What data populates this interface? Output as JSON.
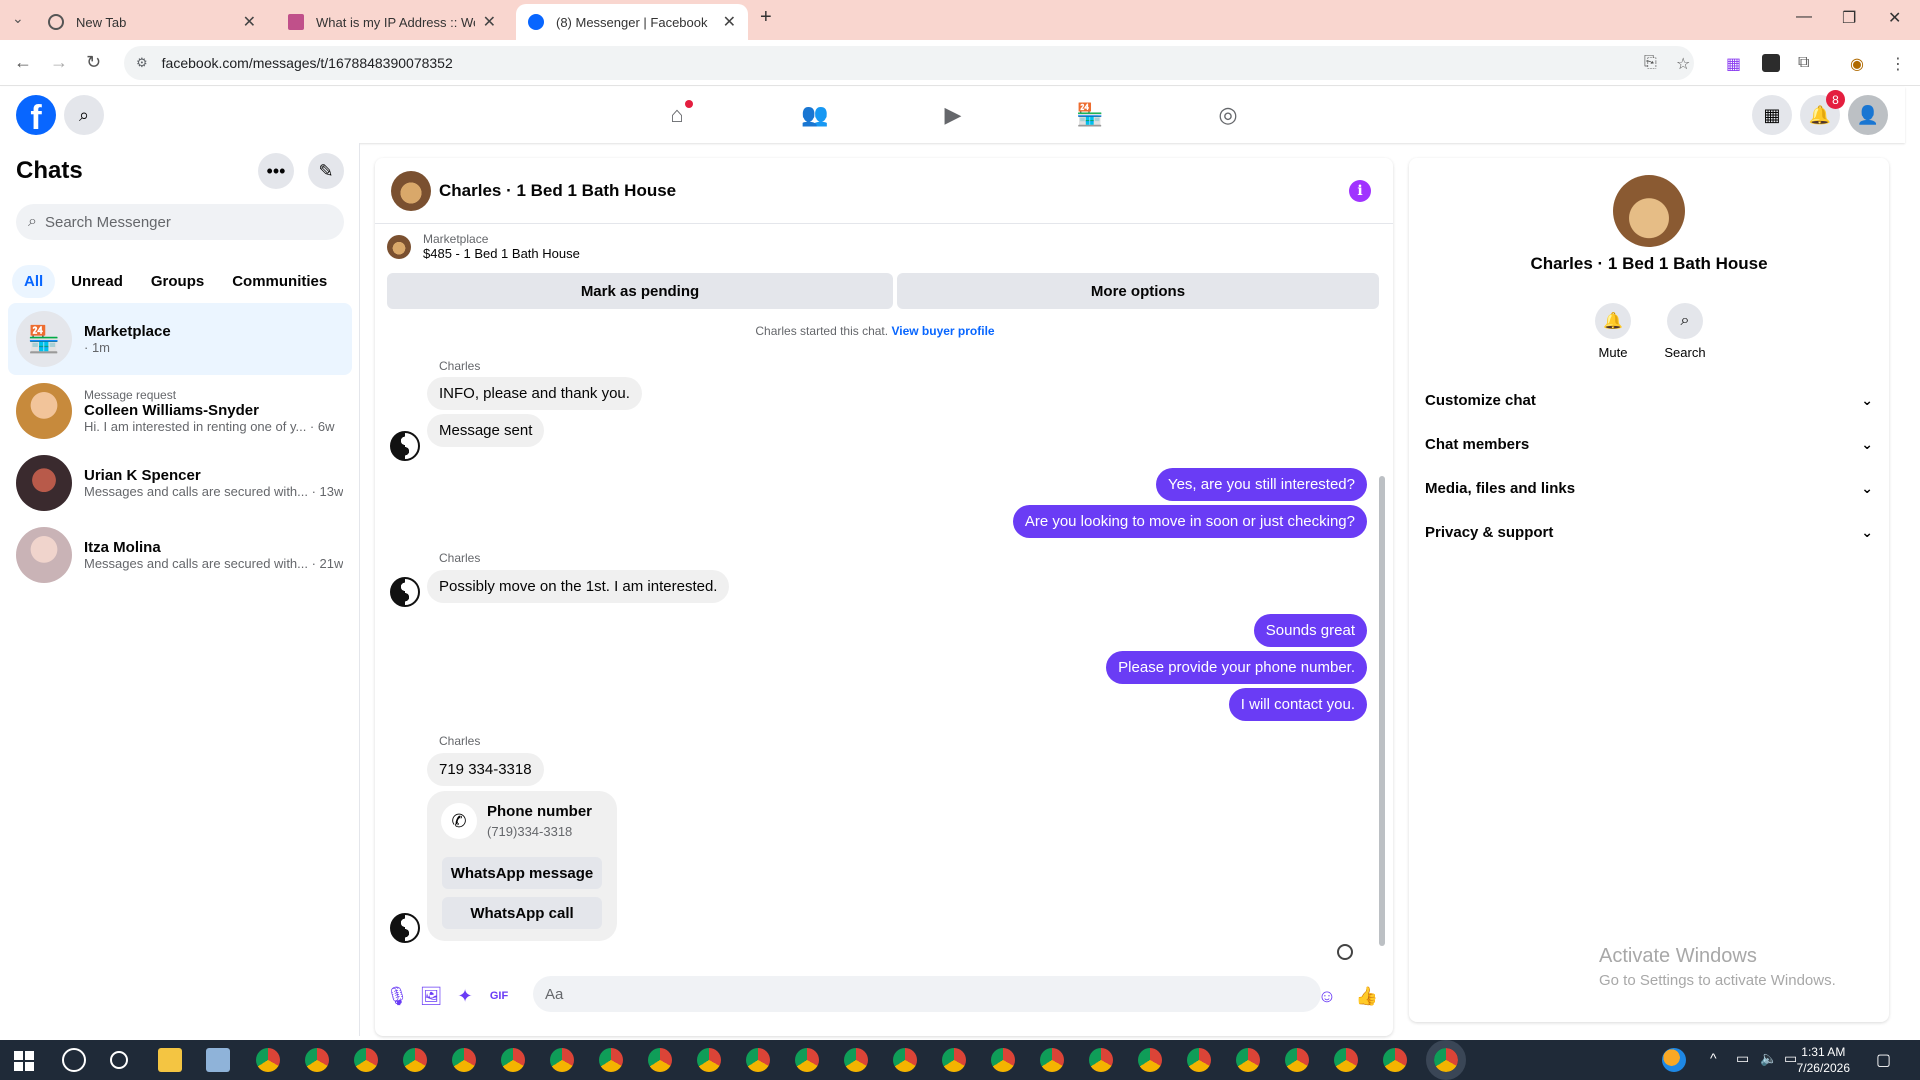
{
  "browser": {
    "tabs": [
      {
        "title": "New Tab"
      },
      {
        "title": "What is my IP Address :: WebBr"
      },
      {
        "title": "(8) Messenger | Facebook"
      }
    ],
    "url": "facebook.com/messages/t/1678848390078352"
  },
  "fb": {
    "notification_count": "8"
  },
  "sidebar": {
    "title": "Chats",
    "search_placeholder": "Search Messenger",
    "filters": [
      "All",
      "Unread",
      "Groups",
      "Communities"
    ],
    "chats": [
      {
        "name": "Marketplace",
        "sub": "· 1m",
        "req": ""
      },
      {
        "name": "Colleen Williams-Snyder",
        "sub": "Hi. I am interested in renting one of y...  · 6w",
        "req": "Message request"
      },
      {
        "name": "Urian K Spencer",
        "sub": "Messages and calls are secured with...  · 13w",
        "req": ""
      },
      {
        "name": "Itza Molina",
        "sub": "Messages and calls are secured with...  · 21w",
        "req": ""
      }
    ]
  },
  "conversation": {
    "title": "Charles · 1 Bed 1 Bath House",
    "marketplace_label": "Marketplace",
    "listing": "$485 - 1 Bed 1 Bath House",
    "mark_pending": "Mark as pending",
    "more_options": "More options",
    "started": "Charles started this chat.",
    "view_buyer": "View buyer profile",
    "sender": "Charles",
    "messages": {
      "in1": "INFO, please and thank you.",
      "in2": "Message sent",
      "out1": "Yes, are you still interested?",
      "out2": "Are you looking to move in soon or just checking?",
      "in3": "Possibly move on the 1st. I am interested.",
      "out3": "Sounds great",
      "out4": "Please provide your phone number.",
      "out5": "I will contact you.",
      "in4": "719 334-3318"
    },
    "phone_card": {
      "title": "Phone number",
      "number": "(719)334-3318",
      "btn1": "WhatsApp message",
      "btn2": "WhatsApp call"
    },
    "composer_placeholder": "Aa"
  },
  "details": {
    "name": "Charles · 1 Bed 1 Bath House",
    "actions": [
      "Mute",
      "Search"
    ],
    "sections": [
      "Customize chat",
      "Chat members",
      "Media, files and links",
      "Privacy & support"
    ]
  },
  "watermark": {
    "line1": "Activate Windows",
    "line2": "Go to Settings to activate Windows."
  },
  "clock": {
    "time": "1:31 AM",
    "date": "7/26/2026"
  },
  "colors": {
    "accent": "#0866ff",
    "outgoing": "#6a3cf5",
    "tabbar": "#f9d6cf"
  }
}
